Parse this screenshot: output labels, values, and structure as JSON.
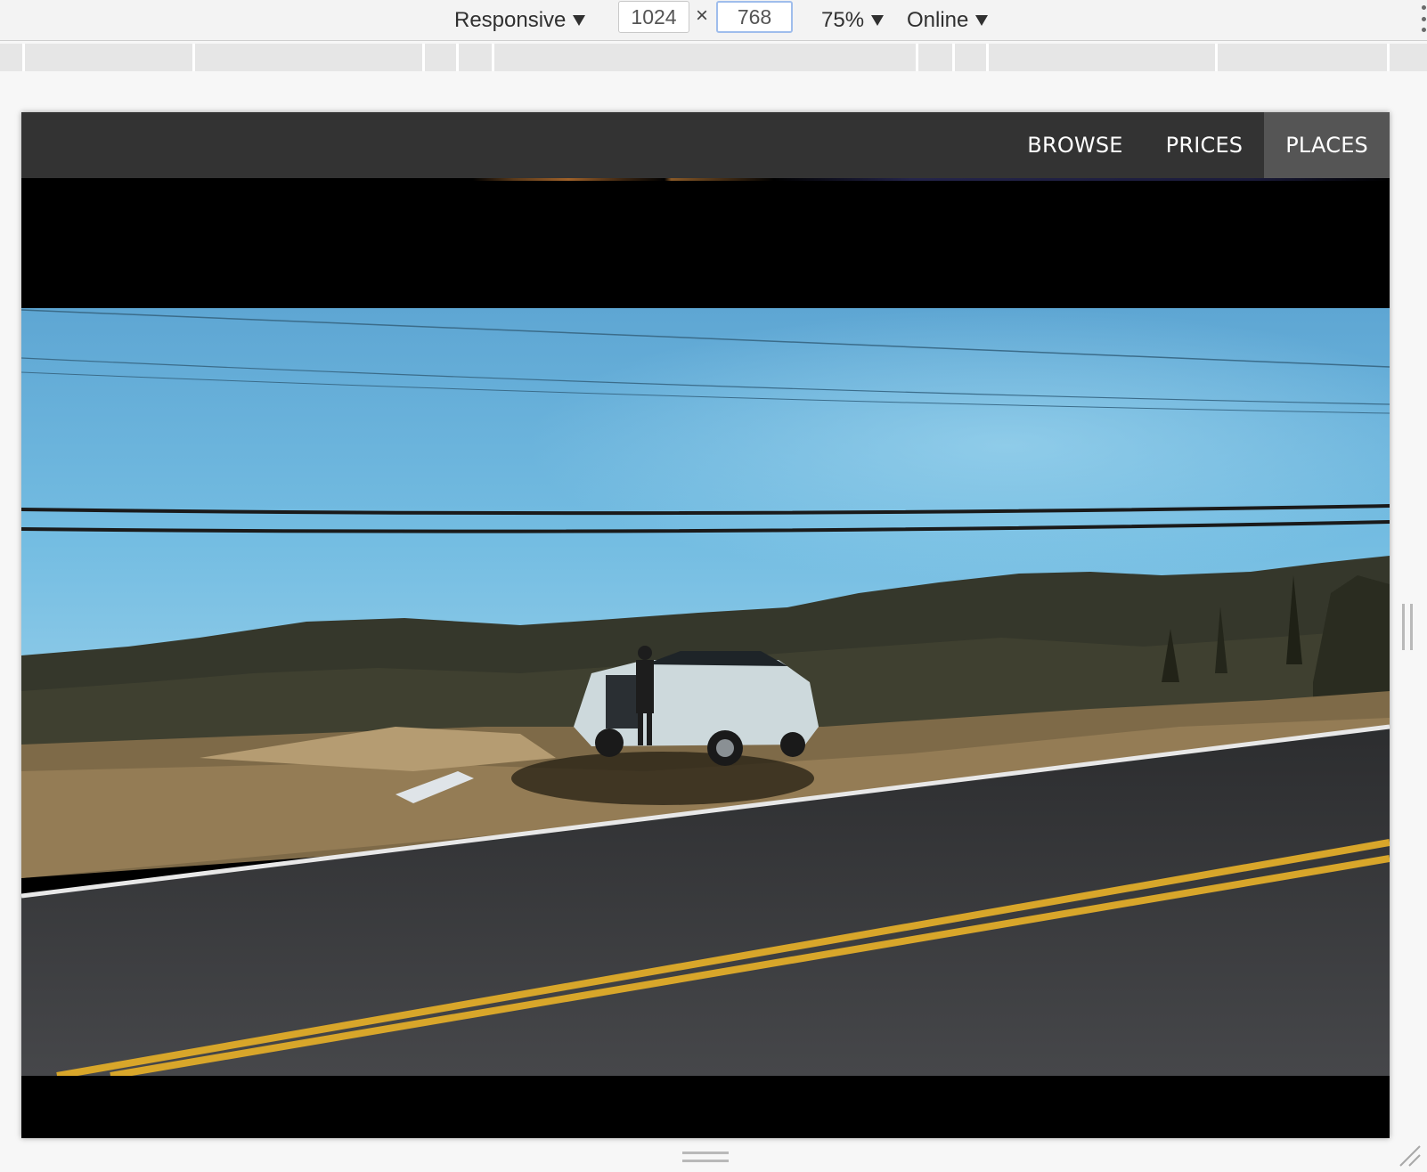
{
  "devtools": {
    "device_label": "Responsive",
    "width_value": "1024",
    "height_value": "768",
    "times": "×",
    "zoom_label": "75%",
    "throttle_label": "Online"
  },
  "site": {
    "nav": [
      {
        "label": "BROWSE",
        "active": false
      },
      {
        "label": "PRICES",
        "active": false
      },
      {
        "label": "PLACES",
        "active": true
      }
    ]
  },
  "colors": {
    "navbar_bg": "#333333",
    "nav_active_bg": "#555555",
    "sky": "#6fb8de",
    "road": "#3a3b3d",
    "road_center_line": "#d8a62a"
  }
}
